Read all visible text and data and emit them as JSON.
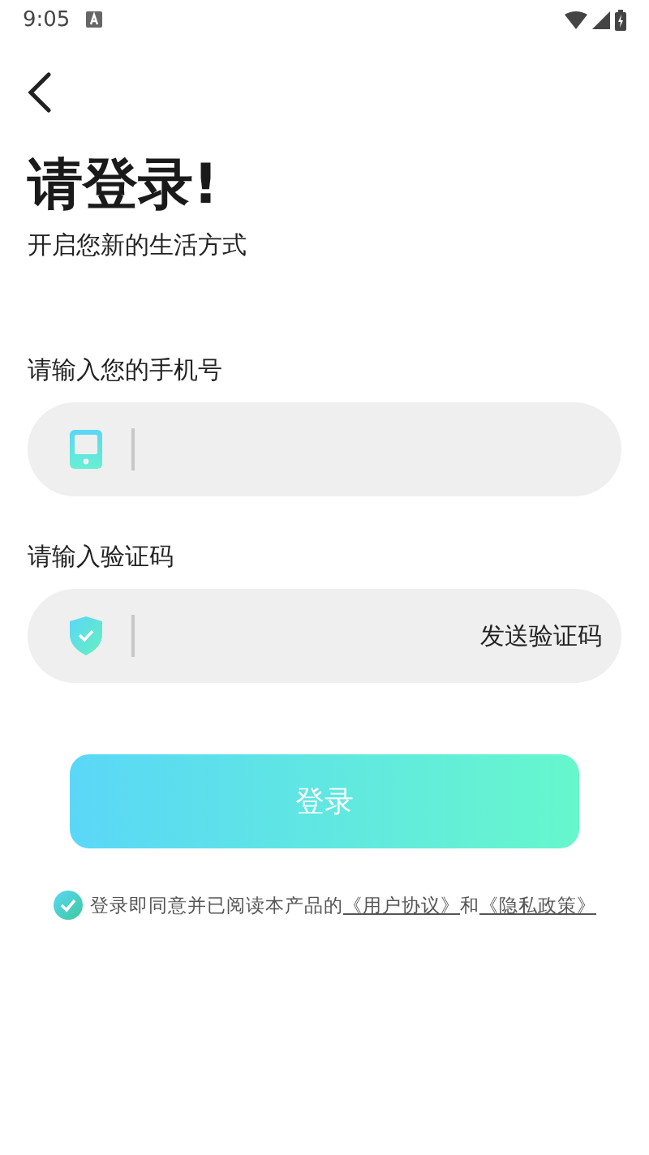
{
  "status_bar": {
    "time": "9:05"
  },
  "title": "请登录!",
  "subtitle": "开启您新的生活方式",
  "phone": {
    "label": "请输入您的手机号"
  },
  "code": {
    "label": "请输入验证码",
    "send_button": "发送验证码"
  },
  "login_button": "登录",
  "agreement": {
    "checked": true,
    "text": "登录即同意并已阅读本产品的",
    "link_terms": "《用户协议》",
    "joiner": "和",
    "link_privacy": "《隐私政策》"
  }
}
